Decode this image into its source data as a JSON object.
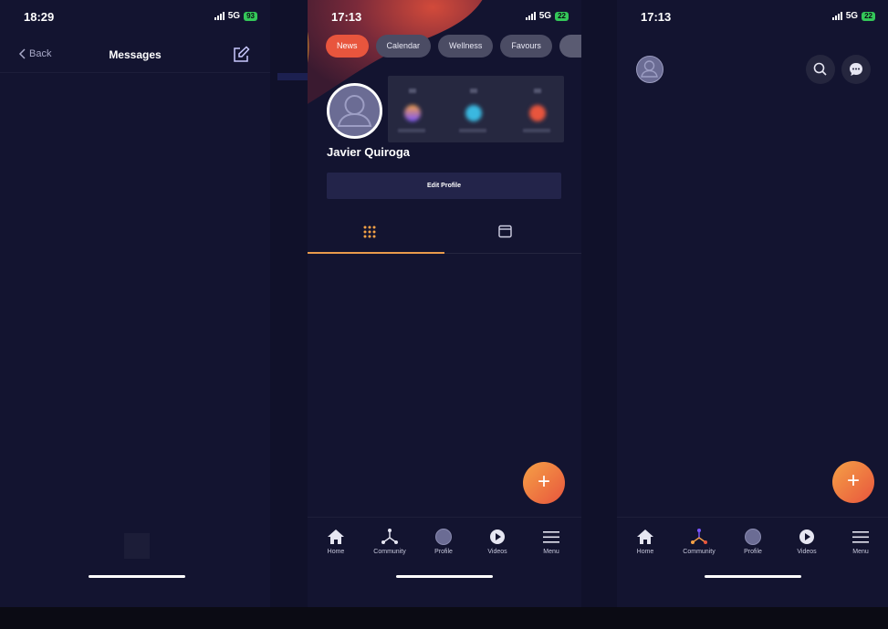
{
  "screen1": {
    "status": {
      "time": "18:29",
      "network": "5G",
      "battery": "93"
    },
    "nav": {
      "back_label": "Back",
      "title": "Messages"
    }
  },
  "screen2": {
    "status": {
      "time": "17:13",
      "network": "5G",
      "battery": "22"
    },
    "chips": [
      "News",
      "Calendar",
      "Wellness",
      "Favours"
    ],
    "profile": {
      "name": "Javier Quiroga",
      "edit_label": "Edit Profile"
    },
    "fab_label": "+"
  },
  "screen3": {
    "status": {
      "time": "17:13",
      "network": "5G",
      "battery": "22"
    },
    "fab_label": "+"
  },
  "tabbar": {
    "items": [
      {
        "label": "Home",
        "icon": "home-icon"
      },
      {
        "label": "Community",
        "icon": "community-icon"
      },
      {
        "label": "Profile",
        "icon": "avatar-icon"
      },
      {
        "label": "Videos",
        "icon": "play-icon"
      },
      {
        "label": "Menu",
        "icon": "menu-icon"
      }
    ]
  },
  "colors": {
    "accent": "#e8553d",
    "accent_light": "#f5a146",
    "background": "#131430"
  }
}
